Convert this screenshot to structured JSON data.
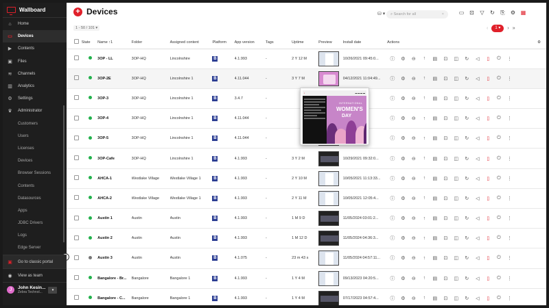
{
  "app": {
    "title": "Wallboard"
  },
  "sidebar": {
    "items": [
      {
        "label": "Home",
        "icon": "home-icon"
      },
      {
        "label": "Devices",
        "icon": "monitor-icon",
        "active": true
      },
      {
        "label": "Contents",
        "icon": "play-icon"
      },
      {
        "label": "Files",
        "icon": "image-icon"
      },
      {
        "label": "Channels",
        "icon": "broadcast-icon"
      },
      {
        "label": "Analytics",
        "icon": "chart-icon"
      },
      {
        "label": "Settings",
        "icon": "gear-icon"
      },
      {
        "label": "Administrator",
        "icon": "admin-icon"
      }
    ],
    "admin_items": [
      "Customers",
      "Users",
      "Licenses",
      "Devices",
      "Browser Sessions",
      "Contents",
      "Datasources",
      "Apps",
      "JDBC Drivers",
      "Logs",
      "Edge Server"
    ],
    "classic_portal": "Go to classic portal",
    "view_as_team": "View as team",
    "user": {
      "initial": "J",
      "name": "John Kesin...",
      "org": "Zebra Technol..."
    }
  },
  "header": {
    "title": "Devices",
    "search_placeholder": "Search for all",
    "search_clear": "×",
    "page_range": "1 - 50 / 101 ▾",
    "current_page": "1 ▾",
    "pager_prev": "‹",
    "pager_next": "›",
    "pager_last": "»"
  },
  "table": {
    "columns": [
      "State",
      "Name ↑1",
      "Folder",
      "Assigned content",
      "Platform",
      "App version",
      "Tags",
      "Uptime",
      "Preview",
      "Install date",
      "Actions"
    ],
    "rows": [
      {
        "state": "#22b14c",
        "name": "3OP - LL",
        "folder": "3OP-HQ",
        "content": "Lincolnshire",
        "platform": "B",
        "version": "4.1.993",
        "tags": "-",
        "uptime": "2 Y 12 M",
        "thumb": "light",
        "install": "10/26/2021 09:45:0..."
      },
      {
        "state": "#22b14c",
        "name": "3OP-2E",
        "folder": "3OP-HQ",
        "content": "Lincolnshire 1",
        "platform": "B",
        "version": "4.11.044",
        "tags": "-",
        "uptime": "3 Y 7 M",
        "thumb": "pink",
        "install": "04/12/2021 11:04:49..."
      },
      {
        "state": "#22b14c",
        "name": "3OP-3",
        "folder": "3OP-HQ",
        "content": "Lincolnshire 1",
        "platform": "B",
        "version": "3.4.7",
        "tags": "-",
        "uptime": "",
        "thumb": "dark",
        "install": "...19..."
      },
      {
        "state": "#22b14c",
        "name": "3OP-4",
        "folder": "3OP-HQ",
        "content": "Lincolnshire 1",
        "platform": "B",
        "version": "4.11.044",
        "tags": "-",
        "uptime": "",
        "thumb": "dark",
        "install": "...2..."
      },
      {
        "state": "#22b14c",
        "name": "3OP-5",
        "folder": "3OP-HQ",
        "content": "Lincolnshire 1",
        "platform": "B",
        "version": "4.11.044",
        "tags": "-",
        "uptime": "",
        "thumb": "dark",
        "install": "...07..."
      },
      {
        "state": "#22b14c",
        "name": "3OP-Cafe",
        "folder": "3OP-HQ",
        "content": "Lincolnshire 1",
        "platform": "B",
        "version": "4.1.993",
        "tags": "-",
        "uptime": "3 Y 2 M",
        "thumb": "dark",
        "install": "10/29/2021 09:32:0..."
      },
      {
        "state": "#22b14c",
        "name": "AHCA-1",
        "folder": "Westlake Village",
        "content": "Westlake Village 1",
        "platform": "B",
        "version": "4.1.993",
        "tags": "-",
        "uptime": "2 Y 10 M",
        "thumb": "light",
        "install": "10/05/2021 11:13:33..."
      },
      {
        "state": "#22b14c",
        "name": "AHCA-2",
        "folder": "Westlake Village",
        "content": "Westlake Village 1",
        "platform": "B",
        "version": "4.1.993",
        "tags": "-",
        "uptime": "2 Y 11 M",
        "thumb": "light",
        "install": "10/05/2021 12:05:4..."
      },
      {
        "state": "#22b14c",
        "name": "Austin 1",
        "folder": "Austin",
        "content": "Austin",
        "platform": "B",
        "version": "4.1.993",
        "tags": "-",
        "uptime": "1 M 9 D",
        "thumb": "dark",
        "install": "11/05/2024 03:01:2..."
      },
      {
        "state": "#22b14c",
        "name": "Austin 2",
        "folder": "Austin",
        "content": "Austin",
        "platform": "B",
        "version": "4.1.993",
        "tags": "-",
        "uptime": "1 M 12 D",
        "thumb": "dark",
        "install": "11/05/2024 04:36:3..."
      },
      {
        "state": "#777777",
        "name": "Austin 3",
        "folder": "Austin",
        "content": "Austin",
        "platform": "B",
        "version": "4.1.075",
        "tags": "-",
        "uptime": "23 m 43 s",
        "thumb": "light",
        "install": "11/05/2024 04:57:11..."
      },
      {
        "state": "#22b14c",
        "name": "Bangalore - Br...",
        "folder": "Bangalore",
        "content": "Bangalore 1",
        "platform": "B",
        "version": "4.1.993",
        "tags": "-",
        "uptime": "1 Y 4 M",
        "thumb": "light",
        "install": "09/13/2023 04:20:5..."
      },
      {
        "state": "#22b14c",
        "name": "Bangalore - C...",
        "folder": "Bangalore",
        "content": "Bangalore 1",
        "platform": "B",
        "version": "4.1.993",
        "tags": "-",
        "uptime": "1 Y 4 M",
        "thumb": "dark",
        "install": "07/17/2023 04:57:4..."
      }
    ]
  },
  "preview_popup": {
    "title_line1": "INTERNATIONAL",
    "title_line2": "WOMEN'S",
    "title_line3": "DAY",
    "accent": "#c785c8"
  },
  "colors": {
    "brand": "#e0202a",
    "sidebar_bg": "#1e1e1e",
    "platform_badge": "#2c3e93"
  }
}
